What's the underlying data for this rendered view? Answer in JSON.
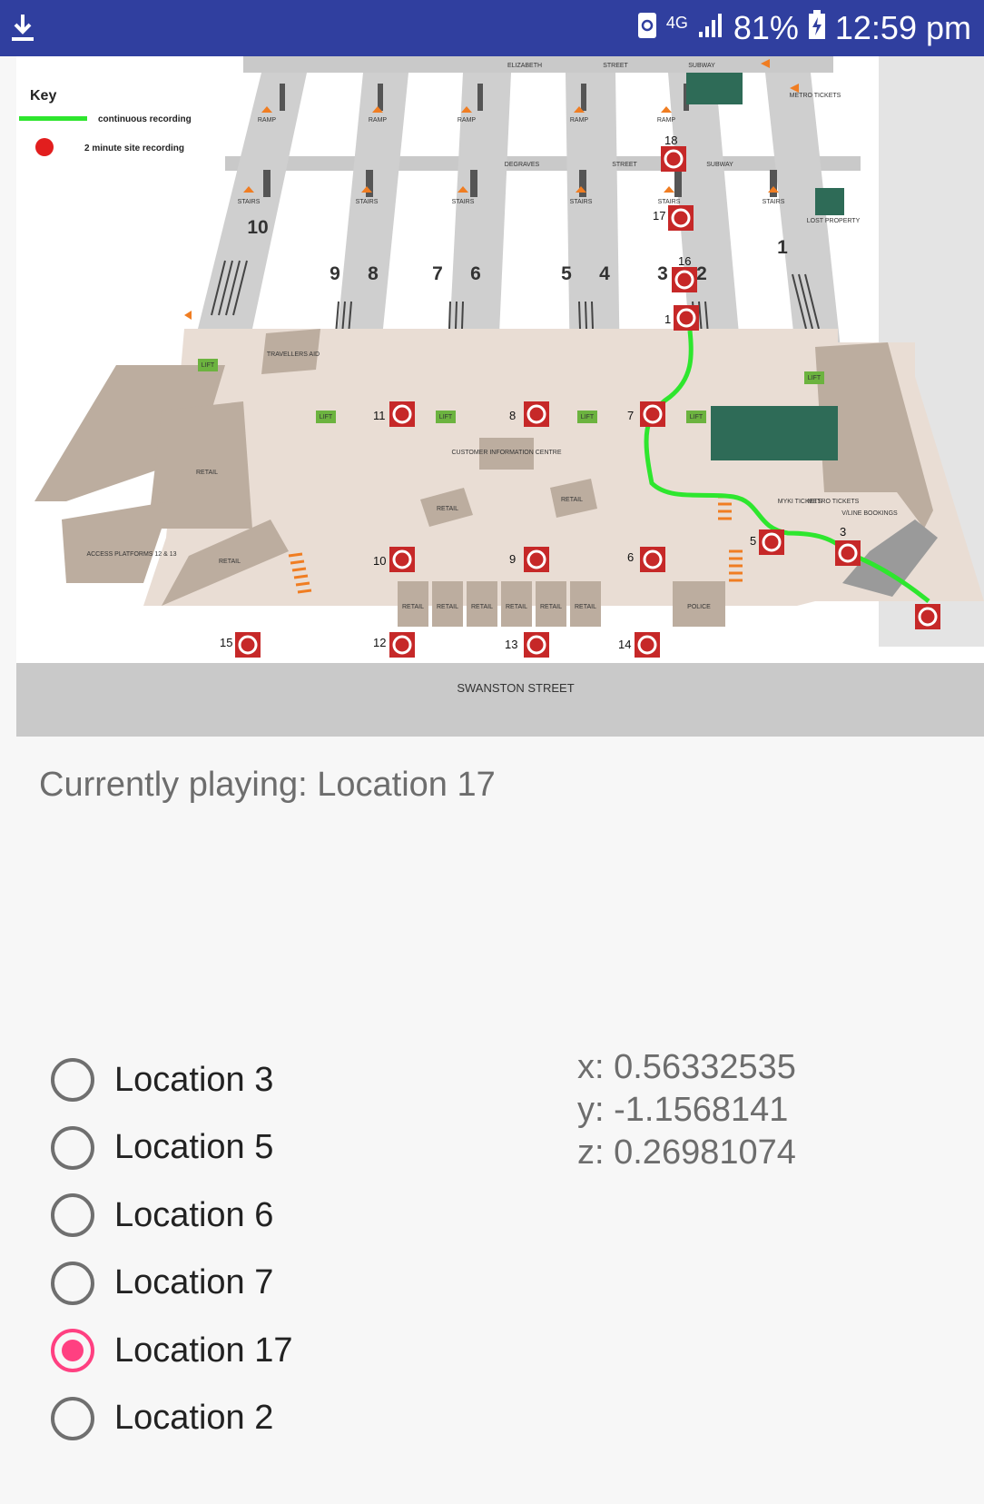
{
  "status_bar": {
    "network": "4G",
    "battery": "81%",
    "time": "12:59 pm",
    "icons": [
      "download-icon",
      "recycle-icon",
      "signal-icon",
      "battery-charging-icon"
    ]
  },
  "map": {
    "key_title": "Key",
    "key_continuous": "continuous recording",
    "key_site": "2 minute site recording",
    "top_street_1": "ELIZABETH",
    "top_street_2": "STREET",
    "top_street_3": "SUBWAY",
    "degraves_1": "DEGRAVES",
    "degraves_2": "STREET",
    "degraves_3": "SUBWAY",
    "metro_tickets": "METRO TICKETS",
    "lost_property": "LOST PROPERTY",
    "travellers_aid": "TRAVELLERS AID",
    "customer_info": "CUSTOMER INFORMATION CENTRE",
    "retail": "RETAIL",
    "police": "POLICE",
    "lift": "LIFT",
    "ramp": "RAMP",
    "stairs": "STAIRS",
    "myki_tickets": "MYKI TICKETS",
    "metro_tickets_small": "METRO TICKETS",
    "vline_bookings": "V/LINE BOOKINGS",
    "access_platforms": "ACCESS PLATFORMS 12 & 13",
    "swanston_street": "SWANSTON STREET",
    "platforms": [
      "10",
      "9",
      "8",
      "7",
      "6",
      "5",
      "4",
      "3",
      "2",
      "1"
    ],
    "markers": [
      "18",
      "17",
      "16",
      "1",
      "11",
      "8",
      "7",
      "10",
      "9",
      "6",
      "5",
      "3",
      "15",
      "12",
      "13",
      "14"
    ]
  },
  "now_playing": "Currently playing: Location 17",
  "locations": [
    {
      "label": "Location 3",
      "checked": false
    },
    {
      "label": "Location 5",
      "checked": false
    },
    {
      "label": "Location 6",
      "checked": false
    },
    {
      "label": "Location 7",
      "checked": false
    },
    {
      "label": "Location 17",
      "checked": true
    },
    {
      "label": "Location 2",
      "checked": false
    }
  ],
  "accelerometer": {
    "x": "x: 0.56332535",
    "y": "y: -1.1568141",
    "z": "z: 0.26981074"
  },
  "colors": {
    "status_bar": "#303f9f",
    "radio_checked": "#ff4081",
    "marker_red": "#c62828",
    "recording_path": "#2ee62e"
  }
}
